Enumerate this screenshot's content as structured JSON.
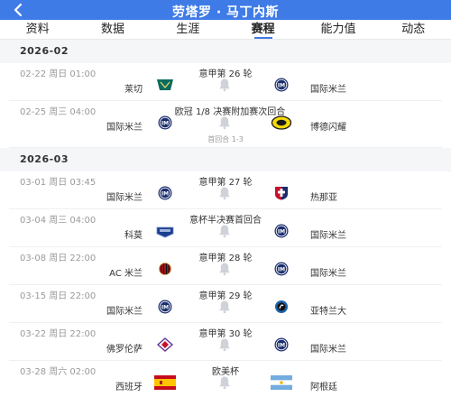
{
  "header": {
    "title": "劳塔罗 · 马丁内斯"
  },
  "tabs": [
    {
      "label": "资料"
    },
    {
      "label": "数据"
    },
    {
      "label": "生涯"
    },
    {
      "label": "赛程"
    },
    {
      "label": "能力值"
    },
    {
      "label": "动态"
    }
  ],
  "active_tab": "赛程",
  "colors": {
    "brand_blue": "#3f7be6",
    "background": "#f5f6f8"
  },
  "months": [
    {
      "label": "2026-02",
      "matches": [
        {
          "time": "02-22  周日 01:00",
          "competition": "意甲第 26 轮",
          "home": "莱切",
          "away": "国际米兰",
          "home_logo": "lecce-logo-icon",
          "away_logo": "inter-logo-icon"
        },
        {
          "time": "02-25  周三 04:00",
          "competition": "欧冠 1/8 决赛附加赛次回合",
          "home": "国际米兰",
          "away": "博德闪耀",
          "home_logo": "inter-logo-icon",
          "away_logo": "bodo-glimt-logo-icon",
          "note": "首回合 1-3"
        }
      ]
    },
    {
      "label": "2026-03",
      "matches": [
        {
          "time": "03-01  周日 03:45",
          "competition": "意甲第 27 轮",
          "home": "国际米兰",
          "away": "热那亚",
          "home_logo": "inter-logo-icon",
          "away_logo": "genoa-logo-icon"
        },
        {
          "time": "03-04  周三 04:00",
          "competition": "意杯半决赛首回合",
          "home": "科莫",
          "away": "国际米兰",
          "home_logo": "como-logo-icon",
          "away_logo": "inter-logo-icon"
        },
        {
          "time": "03-08  周日 22:00",
          "competition": "意甲第 28 轮",
          "home": "AC 米兰",
          "away": "国际米兰",
          "home_logo": "ac-milan-logo-icon",
          "away_logo": "inter-logo-icon"
        },
        {
          "time": "03-15  周日 22:00",
          "competition": "意甲第 29 轮",
          "home": "国际米兰",
          "away": "亚特兰大",
          "home_logo": "inter-logo-icon",
          "away_logo": "atalanta-logo-icon"
        },
        {
          "time": "03-22  周日 22:00",
          "competition": "意甲第 30 轮",
          "home": "佛罗伦萨",
          "away": "国际米兰",
          "home_logo": "fiorentina-logo-icon",
          "away_logo": "inter-logo-icon"
        },
        {
          "time": "03-28  周六 02:00",
          "competition": "欧美杯",
          "home": "西班牙",
          "away": "阿根廷",
          "home_logo": "spain-flag-icon",
          "away_logo": "argentina-flag-icon"
        }
      ]
    }
  ]
}
